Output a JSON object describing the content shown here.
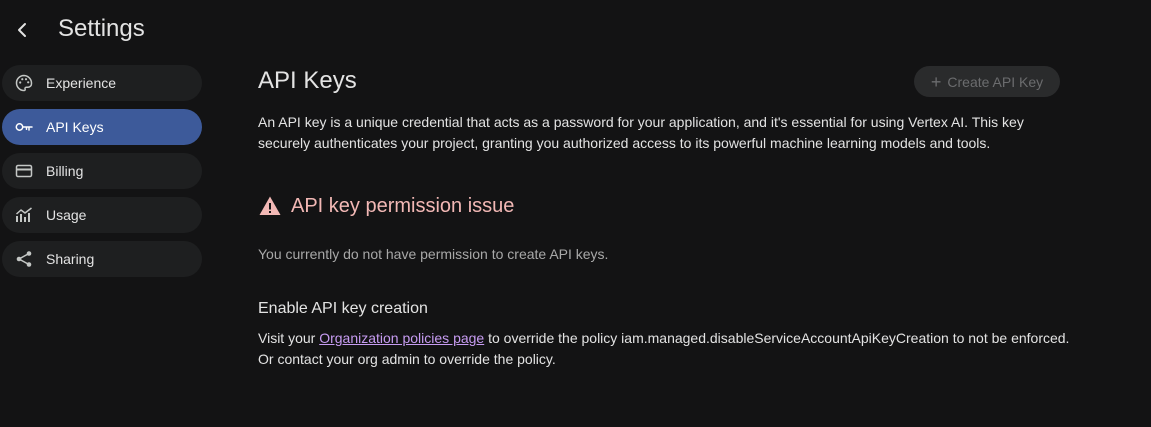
{
  "header": {
    "title": "Settings",
    "back_icon": "arrow-back-icon"
  },
  "sidebar": {
    "items": [
      {
        "label": "Experience",
        "icon": "palette-icon",
        "active": false
      },
      {
        "label": "API Keys",
        "icon": "key-icon",
        "active": true
      },
      {
        "label": "Billing",
        "icon": "credit-card-icon",
        "active": false
      },
      {
        "label": "Usage",
        "icon": "bar-chart-icon",
        "active": false
      },
      {
        "label": "Sharing",
        "icon": "share-icon",
        "active": false
      }
    ]
  },
  "main": {
    "title": "API Keys",
    "create_button": {
      "label": "Create API Key",
      "icon": "plus-icon",
      "disabled": true
    },
    "description": "An API key is a unique credential that acts as a password for your application, and it's essential for using Vertex AI. This key securely authenticates your project, granting you authorized access to its powerful machine learning models and tools.",
    "warning": {
      "icon": "warning-icon",
      "title": "API key permission issue",
      "message": "You currently do not have permission to create API keys."
    },
    "enable": {
      "title": "Enable API key creation",
      "text_before": "Visit your ",
      "link_label": "Organization policies page",
      "text_after": " to override the policy iam.managed.disableServiceAccountApiKeyCreation to not be enforced.",
      "text_line2": "Or contact your org admin to override the policy."
    }
  },
  "colors": {
    "background": "#131314",
    "nav_bg": "#1e1f20",
    "nav_active_bg": "#3d5a9a",
    "warning": "#f2b8b5",
    "link": "#c79cf2"
  }
}
